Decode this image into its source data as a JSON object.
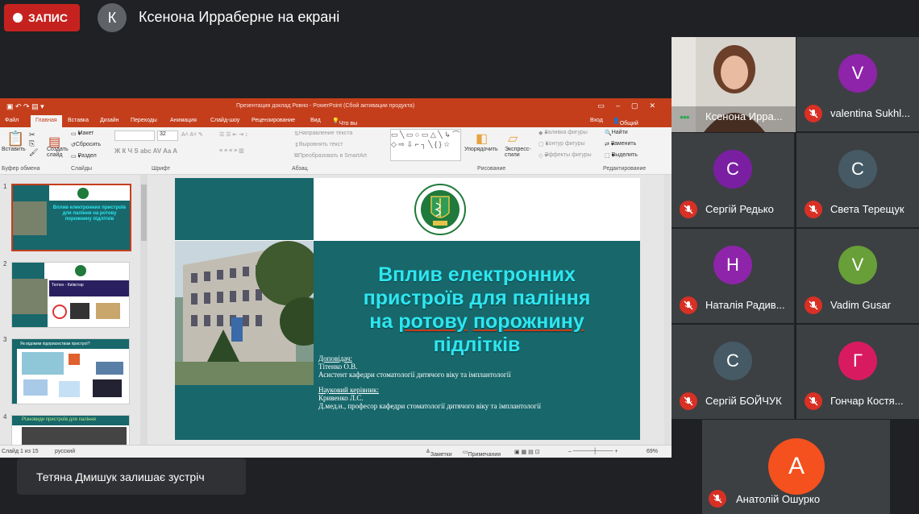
{
  "meet": {
    "record_label": "ЗАПИС",
    "presenter_initial": "К",
    "presenter_text": "Ксенона Ирраберне на екрані",
    "toast": "Тетяна Дмишук залишає зустріч"
  },
  "powerpoint": {
    "title": "Презентация доклад Ровно - PowerPoint (Сбой активации продукта)",
    "tabs": [
      "Файл",
      "Главная",
      "Вставка",
      "Дизайн",
      "Переходы",
      "Анимация",
      "Слайд-шоу",
      "Рецензирование",
      "Вид"
    ],
    "tell_me": "Что вы хотите сделать?",
    "signin": "Вход",
    "share": "Общий доступ",
    "ribbon": {
      "paste": "Вставить",
      "create_slide": "Создать слайд",
      "layout": "Макет",
      "reset": "Сбросить",
      "section": "Раздел",
      "font_size": "32",
      "text_direction": "Направление текста",
      "align_text": "Выровнять текст",
      "smartart": "Преобразовать в SmartArt",
      "arrange": "Упорядочить",
      "quick_styles": "Экспресс-стили",
      "shape_fill": "Заливка фигуры",
      "shape_outline": "Контур фигуры",
      "shape_effects": "Эффекты фигуры",
      "find": "Найти",
      "replace": "Заменить",
      "select": "Выделить",
      "groups": [
        "Буфер обмена",
        "Слайды",
        "Шрифт",
        "Абзац",
        "Рисование",
        "Редактирование"
      ]
    },
    "slide_numbers": [
      "1",
      "2",
      "3",
      "4"
    ],
    "thumb_texts": {
      "t1_title": "Вплив електронних пристроїв для паління на ротову порожнину підлітків",
      "t2_title": "Тютюн - Київстар",
      "t3_title": "Як відомим підприємствам пристрої?",
      "t4_title": "Різновиди пристроїв для паління"
    },
    "status": {
      "slide_of": "Слайд 1 из 15",
      "language": "русский",
      "notes": "Заметки",
      "comments": "Примечания",
      "zoom": "69%"
    },
    "slide": {
      "title_line1": "Вплив електронних",
      "title_line2": "пристроїв для паління",
      "title_line3_a": "на ",
      "title_line3_b": "ротову",
      "title_line3_c": " ",
      "title_line3_d": "порожнину",
      "title_line4": "підлітків",
      "speaker_label": "Доповідач:",
      "speaker_name": "Тітенко О.В.",
      "speaker_role": "Асистент кафедри стоматології дитячого віку та імплантології",
      "supervisor_label": "Науковий керівник:",
      "supervisor_name": "Кривенко Л.С.",
      "supervisor_role": "Д.мед.н., професор кафедри стоматології дитячого віку та імплантології"
    }
  },
  "participants": [
    {
      "name": "Ксенона Ирра...",
      "initial": "",
      "color": "#c8c6c4"
    },
    {
      "name": "valentina Sukhl...",
      "initial": "V",
      "color": "#8e24aa"
    },
    {
      "name": "Сергій Редько",
      "initial": "С",
      "color": "#7b1fa2"
    },
    {
      "name": "Света Терещук",
      "initial": "С",
      "color": "#455a64"
    },
    {
      "name": "Наталія Радив...",
      "initial": "Н",
      "color": "#8e24aa"
    },
    {
      "name": "Vadim Gusar",
      "initial": "V",
      "color": "#689f38"
    },
    {
      "name": "Сергій БОЙЧУК",
      "initial": "С",
      "color": "#455a64"
    },
    {
      "name": "Гончар Костя...",
      "initial": "Г",
      "color": "#d81b60"
    },
    {
      "name": "Анатолій Ошурко",
      "initial": "А",
      "color": "#f4511e"
    }
  ]
}
